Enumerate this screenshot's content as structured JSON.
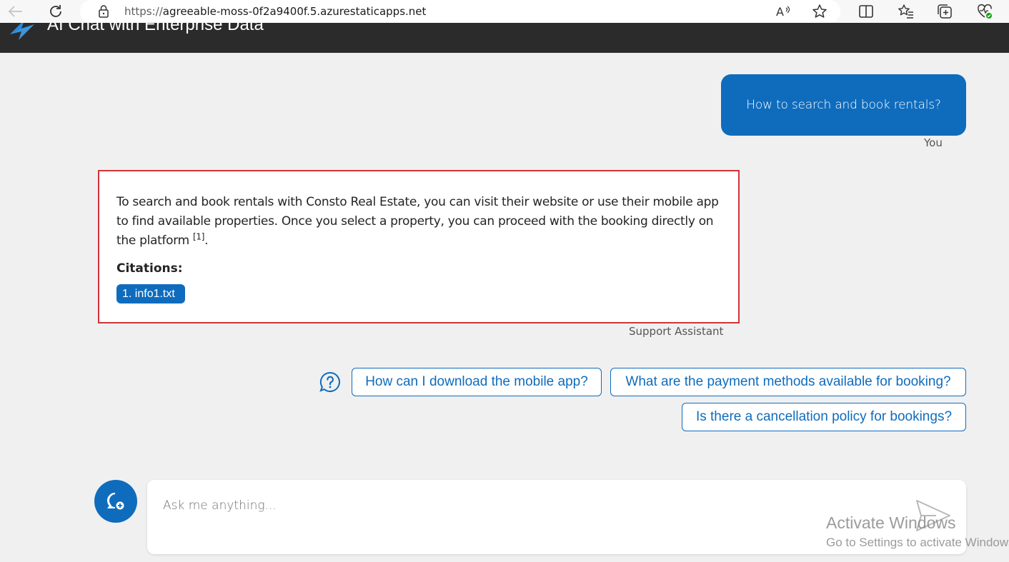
{
  "browser": {
    "url_prefix": "https://",
    "url_host": "agreeable-moss-0f2a9400f.5.azurestaticapps.net",
    "icons": [
      "back-icon",
      "refresh-icon",
      "lock-icon",
      "read-aloud-icon",
      "favorite-star-icon",
      "split-screen-icon",
      "favorites-icon",
      "collections-icon",
      "browser-essentials-icon"
    ]
  },
  "header": {
    "title": "AI Chat with Enterprise Data"
  },
  "chat": {
    "user_message": "How to search and book rentals?",
    "user_label": "You",
    "assistant_message": "To search and book rentals with Consto Real Estate, you can visit their website or use their mobile app to find available properties. Once you select a property, you can proceed with the booking directly on the platform",
    "assistant_citation_marker": "[1]",
    "assistant_message_end": ".",
    "citations_heading": "Citations:",
    "citations": [
      "1. info1.txt"
    ],
    "assistant_label": "Support Assistant"
  },
  "suggestions": [
    "How can I download the mobile app?",
    "What are the payment methods available for booking?",
    "Is there a cancellation policy for bookings?"
  ],
  "input": {
    "placeholder": "Ask me anything..."
  },
  "watermark": {
    "title": "Activate Windows",
    "subtitle": "Go to Settings to activate Windows."
  },
  "colors": {
    "accent": "#0f6cbd",
    "highlight_border": "#d13438",
    "header_bg": "#2b2b2b",
    "page_bg": "#f0f0f0"
  }
}
